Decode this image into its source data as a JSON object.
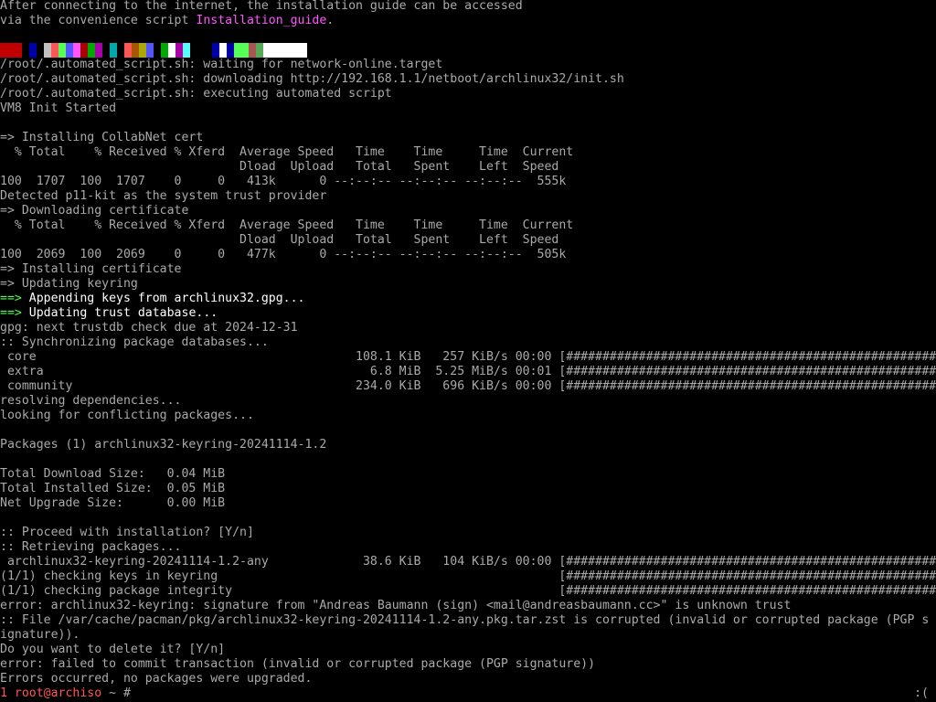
{
  "intro": {
    "line1": "After connecting to the internet, the installation guide can be accessed",
    "line2_prefix": "via the convenience script ",
    "line2_link": "Installation_guide",
    "line2_suffix": "."
  },
  "color_blocks": [
    "#c00000",
    "#c00000",
    "#c00000",
    "#000000",
    "#0000aa",
    "#000000",
    "#c0c0c0",
    "#ff5555",
    "#55ff55",
    "#5555ff",
    "#ff55ff",
    "#aa0000",
    "#00aa00",
    "#aa00aa",
    "#000000",
    "#00aaaa",
    "#000000",
    "#ff5555",
    "#aa5500",
    "#aaaa00",
    "#5555ff",
    "#000000",
    "#00aa00",
    "#ffffff",
    "#aa00aa",
    "#55ffff",
    "#000000",
    "#000000",
    "#000000",
    "#0000aa",
    "#ffffff",
    "#0000aa",
    "#55ff55",
    "#55ff55",
    "#aa5555",
    "#55aa55",
    "#ffffff",
    "#ffffff",
    "#ffffff",
    "#ffffff",
    "#ffffff",
    "#ffffff"
  ],
  "log": {
    "l04": "/root/.automated_script.sh: waiting for network-online.target",
    "l05": "/root/.automated_script.sh: downloading http://192.168.1.1/netboot/archlinux32/init.sh",
    "l06": "/root/.automated_script.sh: executing automated script",
    "l07": "VM8 Init Started",
    "l08": "",
    "l09": "=> Installing CollabNet cert",
    "l10": "  % Total    % Received % Xferd  Average Speed   Time    Time     Time  Current",
    "l11": "                                 Dload  Upload   Total   Spent    Left  Speed",
    "l12": "100  1707  100  1707    0     0   413k      0 --:--:-- --:--:-- --:--:--  555k",
    "l13": "Detected p11-kit as the system trust provider",
    "l14": "=> Downloading certificate",
    "l15": "  % Total    % Received % Xferd  Average Speed   Time    Time     Time  Current",
    "l16": "                                 Dload  Upload   Total   Spent    Left  Speed",
    "l17": "100  2069  100  2069    0     0   477k      0 --:--:-- --:--:-- --:--:--  505k",
    "l18": "=> Installing certificate",
    "l19": "=> Updating keyring",
    "l20_arrow": "==>",
    "l20_text": " Appending keys from archlinux32.gpg...",
    "l21_arrow": "==>",
    "l21_text": " Updating trust database...",
    "l22": "gpg: next trustdb check due at 2024-12-31",
    "l23": ":: Synchronizing package databases...",
    "l24": " core                                            108.1 KiB   257 KiB/s 00:00 [######################################################] 100%",
    "l25": " extra                                             6.8 MiB  5.25 MiB/s 00:01 [######################################################] 100%",
    "l26": " community                                       234.0 KiB   696 KiB/s 00:00 [######################################################] 100%",
    "l27": "resolving dependencies...",
    "l28": "looking for conflicting packages...",
    "l29": "",
    "l30": "Packages (1) archlinux32-keyring-20241114-1.2",
    "l31": "",
    "l32": "Total Download Size:   0.04 MiB",
    "l33": "Total Installed Size:  0.05 MiB",
    "l34": "Net Upgrade Size:      0.00 MiB",
    "l35": "",
    "l36": ":: Proceed with installation? [Y/n]",
    "l37": ":: Retrieving packages...",
    "l38": " archlinux32-keyring-20241114-1.2-any             38.6 KiB   104 KiB/s 00:00 [######################################################] 100%",
    "l39": "(1/1) checking keys in keyring                                               [######################################################] 100%",
    "l40": "(1/1) checking package integrity                                             [######################################################] 100%",
    "l41": "error: archlinux32-keyring: signature from \"Andreas Baumann (sign) <mail@andreasbaumann.cc>\" is unknown trust",
    "l42": ":: File /var/cache/pacman/pkg/archlinux32-keyring-20241114-1.2-any.pkg.tar.zst is corrupted (invalid or corrupted package (PGP s",
    "l43": "ignature)).",
    "l44": "Do you want to delete it? [Y/n]",
    "l45": "error: failed to commit transaction (invalid or corrupted package (PGP signature))",
    "l46": "Errors occurred, no packages were upgraded."
  },
  "prompt": {
    "exit_code": "1",
    "user_host": "root@archiso",
    "path": " ~ #",
    "status_right": ":("
  },
  "colors": {
    "background": "#000000",
    "text": "#aaaaaa",
    "bright": "#ffffff",
    "accent_green": "#55ff55",
    "link_magenta": "#ff55ff",
    "prompt_red": "#ff5555"
  }
}
